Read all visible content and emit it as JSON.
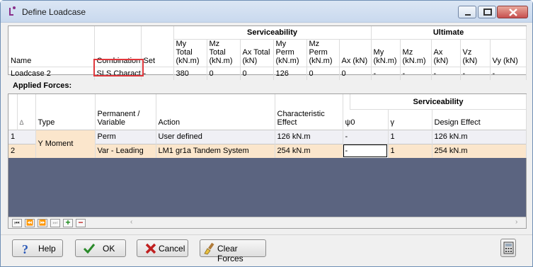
{
  "window": {
    "title": "Define Loadcase"
  },
  "loadcase_table": {
    "group_headers": {
      "serviceability": "Serviceability",
      "ultimate": "Ultimate"
    },
    "columns": [
      "Name",
      "Combination",
      "Set",
      "My Total (kN.m)",
      "Mz Total (kN.m)",
      "Ax Total (kN)",
      "My Perm (kN.m)",
      "Mz Perm (kN.m)",
      "Ax (kN)",
      "My (kN.m)",
      "Mz (kN.m)",
      "Ax (kN)",
      "Vz (kN)",
      "Vy (kN)"
    ],
    "row": [
      "Loadcase 2",
      "SLS Characte",
      "-",
      "380",
      "0",
      "0",
      "126",
      "0",
      "0",
      "-",
      "-",
      "-",
      "-",
      "-"
    ]
  },
  "applied_forces": {
    "title": "Applied Forces:",
    "group_header": "Serviceability",
    "columns": [
      "Δ",
      "Type",
      "Permanent / Variable",
      "Action",
      "Characteristic Effect",
      "ψ0",
      "γ",
      "Design Effect"
    ],
    "type_merged": "Y Moment",
    "rows": [
      {
        "n": "1",
        "perm": "Perm",
        "action": "User defined",
        "char": "126 kN.m",
        "psi": "-",
        "gamma": "1",
        "design": "126 kN.m"
      },
      {
        "n": "2",
        "perm": "Var - Leading",
        "action": "LM1 gr1a Tandem System",
        "char": "254 kN.m",
        "psi": "-",
        "gamma": "1",
        "design": "254 kN.m"
      }
    ]
  },
  "buttons": {
    "help": "Help",
    "ok": "OK",
    "cancel": "Cancel",
    "clear_forces": "Clear Forces"
  },
  "icons": [
    "app-icon",
    "minimize-icon",
    "maximize-icon",
    "close-icon",
    "help-icon",
    "check-icon",
    "cancel-x-icon",
    "clear-brush-icon",
    "calculator-icon"
  ],
  "colors": {
    "highlight_row": "#fbe6cc",
    "empty_area": "#5b6480",
    "annotation_box": "#e0383d"
  }
}
